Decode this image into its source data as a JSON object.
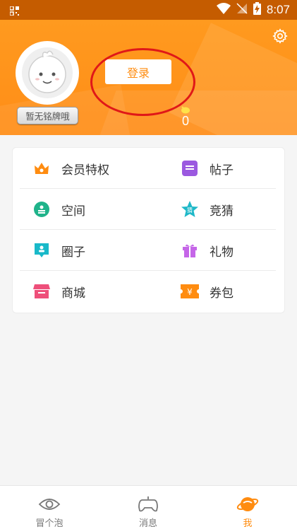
{
  "status_bar": {
    "time": "8:07"
  },
  "profile": {
    "medal_text": "暂无铭牌哦",
    "login_label": "登录",
    "coin_count": "0"
  },
  "menu": [
    [
      {
        "label": "会员特权",
        "icon": "crown-icon",
        "color": "#ff8c10"
      },
      {
        "label": "帖子",
        "icon": "post-icon",
        "color": "#9b59e0"
      }
    ],
    [
      {
        "label": "空间",
        "icon": "space-icon",
        "color": "#1fb38a"
      },
      {
        "label": "竞猜",
        "icon": "guess-star-icon",
        "color": "#1fb8c8"
      }
    ],
    [
      {
        "label": "圈子",
        "icon": "circle-chat-icon",
        "color": "#19b9c9"
      },
      {
        "label": "礼物",
        "icon": "gift-icon",
        "color": "#c566e8"
      }
    ],
    [
      {
        "label": "商城",
        "icon": "shop-icon",
        "color": "#ee4f7a"
      },
      {
        "label": "券包",
        "icon": "coupon-icon",
        "color": "#ff8c10"
      }
    ]
  ],
  "guess_badge": "猜",
  "coupon_symbol": "¥",
  "bottom_nav": [
    {
      "label": "冒个泡",
      "icon": "eye-icon",
      "active": false
    },
    {
      "label": "消息",
      "icon": "gamepad-icon",
      "active": false
    },
    {
      "label": "我",
      "icon": "planet-icon",
      "active": true
    }
  ],
  "colors": {
    "accent": "#ff8c10",
    "header": "#ff9a1f",
    "annotation": "#e01818"
  }
}
